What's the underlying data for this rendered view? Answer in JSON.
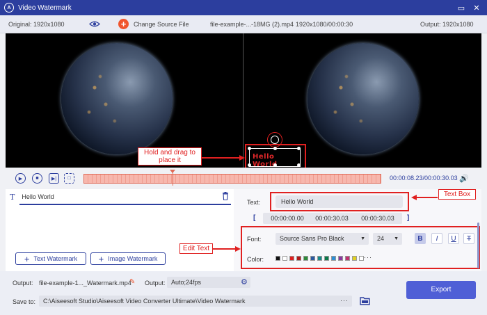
{
  "window": {
    "title": "Video Watermark",
    "minimize": "▭",
    "close": "✕"
  },
  "toolbar": {
    "original": "Original: 1920x1080",
    "change_source": "Change Source File",
    "file_name": "file-example-...-18MG (2).mp4",
    "file_info": "1920x1080/00:00:30",
    "output": "Output: 1920x1080"
  },
  "preview": {
    "watermark_text": "Hello  World",
    "annotation_drag": "Hold and drag to place it"
  },
  "player": {
    "timecode": "00:00:08.23/00:00:30.03"
  },
  "watermark_list": {
    "items": [
      {
        "label": "Hello World"
      }
    ],
    "add_text_label": "Text Watermark",
    "add_image_label": "Image Watermark"
  },
  "settings": {
    "text_label": "Text:",
    "text_value": "Hello World",
    "annotation_textbox": "Text Box",
    "start_time": "00:00:00.00",
    "duration": "00:00:30.03",
    "end_time": "00:00:30.03",
    "font_label": "Font:",
    "font_value": "Source Sans Pro Black",
    "size_value": "24",
    "bold": "B",
    "italic": "I",
    "underline": "U",
    "strike": "T",
    "color_label": "Color:",
    "annotation_edit": "Edit Text",
    "more_colors": "···",
    "colors": [
      "#111111",
      "#ffffff",
      "#e02020",
      "#b01818",
      "#2e8b3a",
      "#2c5aa0",
      "#1a8a8a",
      "#0a7a4a",
      "#2d8fd6",
      "#8a3aa0",
      "#c03070",
      "#e0d020",
      "#ffffff"
    ]
  },
  "bottom": {
    "output_label": "Output:",
    "output_file": "file-example-1..._Watermark.mp4",
    "output2_label": "Output:",
    "output_format": "Auto;24fps",
    "save_label": "Save to:",
    "save_path": "C:\\Aiseesoft Studio\\Aiseesoft Video Converter Ultimate\\Video Watermark",
    "browse": "···",
    "export": "Export"
  }
}
